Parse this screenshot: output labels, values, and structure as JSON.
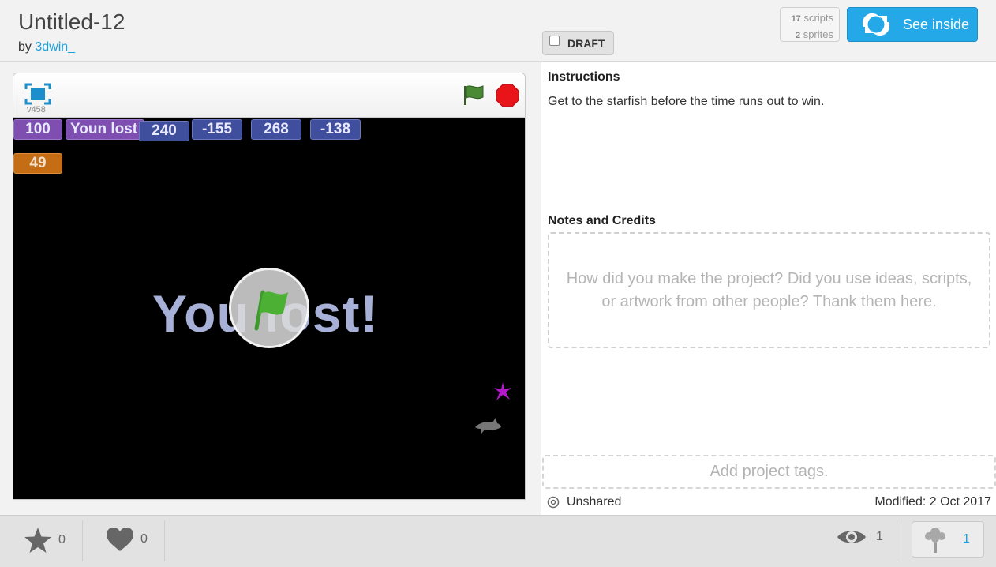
{
  "project": {
    "title": "Untitled-12",
    "by_prefix": "by",
    "author": "3dwin_",
    "draft_label": "DRAFT",
    "scripts_count": "17",
    "scripts_label": "scripts",
    "sprites_count": "2",
    "sprites_label": "sprites",
    "see_inside_label": "See inside"
  },
  "player": {
    "version": "v458",
    "monitors": [
      "100",
      "Youn lost",
      "240",
      "-155",
      "268",
      "-138",
      "49"
    ],
    "stage_text": "You lost!"
  },
  "instructions": {
    "heading": "Instructions",
    "text": "Get to the starfish before the time runs out to win."
  },
  "notes": {
    "heading": "Notes and Credits",
    "placeholder": "How did you make the project? Did you use ideas, scripts, or artwork from other people? Thank them here."
  },
  "tags": {
    "placeholder": "Add project tags."
  },
  "status": {
    "sharing": "Unshared",
    "modified": "Modified: 2 Oct 2017"
  },
  "footer": {
    "favorites": "0",
    "loves": "0",
    "views": "1",
    "remixes": "1"
  },
  "colors": {
    "accent": "#25a8e8",
    "link": "#1aa0d8",
    "stage_bg": "#000000",
    "monitor_purple": "#7e4fb0",
    "monitor_blue": "#3f4f9e",
    "monitor_orange": "#c46d15"
  }
}
